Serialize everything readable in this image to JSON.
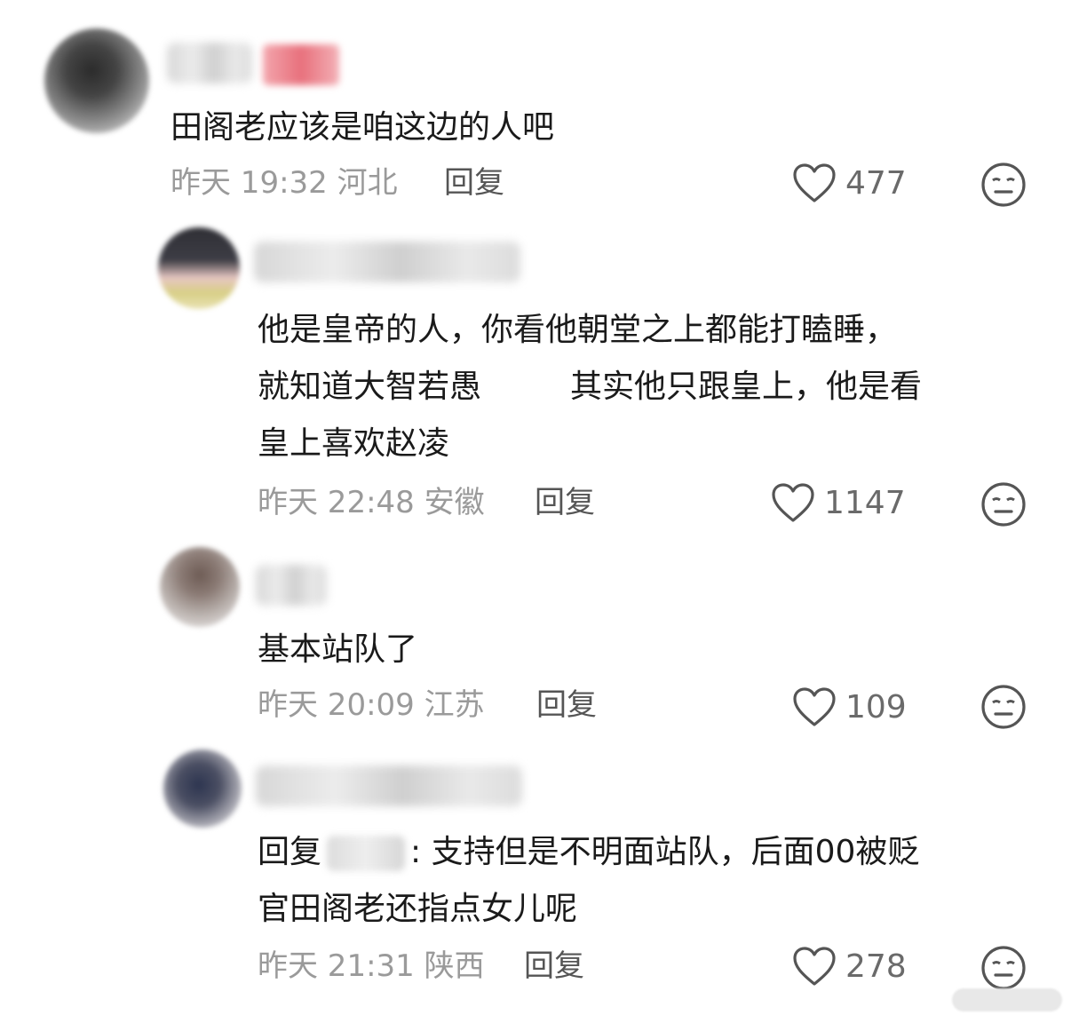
{
  "comments": [
    {
      "text_lines": [
        "田阁老应该是咱这边的人吧"
      ],
      "time": "昨天 19:32",
      "location": "河北",
      "reply_label": "回复",
      "likes": "477"
    },
    {
      "text_lines": [
        "他是皇帝的人，你看他朝堂之上都能打瞌睡，",
        "就知道大智若愚",
        "其实他只跟皇上，他是看",
        "皇上喜欢赵凌"
      ],
      "time": "昨天 22:48",
      "location": "安徽",
      "reply_label": "回复",
      "likes": "1147"
    },
    {
      "text_lines": [
        "基本站队了"
      ],
      "time": "昨天 20:09",
      "location": "江苏",
      "reply_label": "回复",
      "likes": "109"
    },
    {
      "reply_prefix": "回复",
      "text_lines": [
        ": 支持但是不明面站队，后面00被贬",
        "官田阁老还指点女儿呢"
      ],
      "time": "昨天 21:31",
      "location": "陕西",
      "reply_label": "回复",
      "likes": "278"
    }
  ],
  "icons": {
    "like": "heart-outline-icon",
    "dislike": "meh-face-icon"
  },
  "colors": {
    "text": "#1a1a1a",
    "meta": "#9a9a9a",
    "icon": "#555555"
  }
}
